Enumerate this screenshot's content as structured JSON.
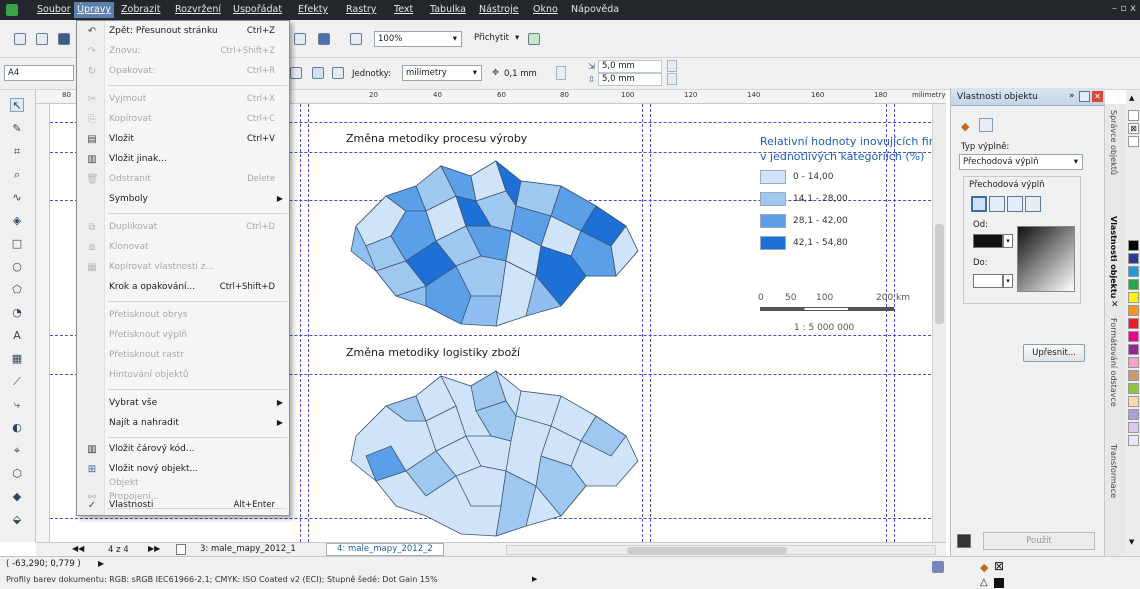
{
  "menubar": {
    "items": [
      "Soubor",
      "Úpravy",
      "Zobrazit",
      "Rozvržení",
      "Uspořádat",
      "Efekty",
      "Rastry",
      "Text",
      "Tabulka",
      "Nástroje",
      "Okno",
      "Nápověda"
    ],
    "window_controls": "– ▫ x"
  },
  "toolbar": {
    "zoom": "100%",
    "snap": "Přichytit",
    "page_size": "A4",
    "units_label": "Jednotky:",
    "units_value": "milimetry",
    "nudge": "0,1 mm",
    "dup_x": "5,0 mm",
    "dup_y": "5,0 mm"
  },
  "ruler": {
    "unit": "milimetry",
    "ticks": [
      "80",
      "20",
      "40",
      "60",
      "80",
      "100",
      "120",
      "140",
      "160",
      "180"
    ]
  },
  "edit_menu": {
    "items": [
      {
        "label": "Zpět: Přesunout stránku",
        "shortcut": "Ctrl+Z",
        "enabled": true,
        "icon": "undo-icon"
      },
      {
        "label": "Znovu:",
        "shortcut": "Ctrl+Shift+Z",
        "enabled": false,
        "icon": "redo-icon"
      },
      {
        "label": "Opakovat:",
        "shortcut": "Ctrl+R",
        "enabled": false,
        "icon": "repeat-icon"
      },
      {
        "label": "Vyjmout",
        "shortcut": "Ctrl+X",
        "enabled": false,
        "icon": "cut-icon"
      },
      {
        "label": "Kopírovat",
        "shortcut": "Ctrl+C",
        "enabled": false,
        "icon": "copy-icon"
      },
      {
        "label": "Vložit",
        "shortcut": "Ctrl+V",
        "enabled": true,
        "icon": "paste-icon"
      },
      {
        "label": "Vložit jinak...",
        "shortcut": "",
        "enabled": true,
        "icon": "paste-special-icon"
      },
      {
        "label": "Odstranit",
        "shortcut": "Delete",
        "enabled": false,
        "icon": "delete-icon"
      },
      {
        "label": "Symboly",
        "shortcut": "",
        "enabled": true,
        "icon": "",
        "submenu": true
      },
      {
        "label": "Duplikovat",
        "shortcut": "Ctrl+D",
        "enabled": false,
        "icon": "duplicate-icon"
      },
      {
        "label": "Klonovat",
        "shortcut": "",
        "enabled": false,
        "icon": "clone-icon"
      },
      {
        "label": "Kopírovat vlastnosti z...",
        "shortcut": "",
        "enabled": false,
        "icon": "copy-properties-icon"
      },
      {
        "label": "Krok a opakování...",
        "shortcut": "Ctrl+Shift+D",
        "enabled": true,
        "icon": ""
      },
      {
        "label": "Přetisknout obrys",
        "shortcut": "",
        "enabled": false,
        "icon": ""
      },
      {
        "label": "Přetisknout výplň",
        "shortcut": "",
        "enabled": false,
        "icon": ""
      },
      {
        "label": "Přetisknout rastr",
        "shortcut": "",
        "enabled": false,
        "icon": ""
      },
      {
        "label": "Hintování objektů",
        "shortcut": "",
        "enabled": false,
        "icon": ""
      },
      {
        "label": "Vybrat vše",
        "shortcut": "",
        "enabled": true,
        "icon": "",
        "submenu": true
      },
      {
        "label": "Najít a nahradit",
        "shortcut": "",
        "enabled": true,
        "icon": "",
        "submenu": true
      },
      {
        "label": "Vložit čárový kód...",
        "shortcut": "",
        "enabled": true,
        "icon": "barcode-icon"
      },
      {
        "label": "Vložit nový objekt...",
        "shortcut": "",
        "enabled": true,
        "icon": "new-object-icon"
      },
      {
        "label": "Objekt",
        "shortcut": "",
        "enabled": false,
        "icon": ""
      },
      {
        "label": "Propojení...",
        "shortcut": "",
        "enabled": false,
        "icon": "link-icon"
      },
      {
        "label": "Vlastnosti",
        "shortcut": "Alt+Enter",
        "enabled": true,
        "icon": "check-icon"
      }
    ]
  },
  "canvas": {
    "map1_title": "Změna metodiky procesu výroby",
    "map2_title": "Změna metodiky logistiky zboží",
    "legend_title_1": "Relativní hodnoty inovujících fire",
    "legend_title_2": "v jednotlivých kategoriích (%)",
    "legend": [
      {
        "label": "0 - 14,00",
        "color": "#cfe4f8"
      },
      {
        "label": "14,1 - 28,00",
        "color": "#9fc8f1"
      },
      {
        "label": "28,1 - 42,00",
        "color": "#5b9fe9"
      },
      {
        "label": "42,1 - 54,80",
        "color": "#1e6fd6"
      }
    ],
    "scale_labels": [
      "0",
      "50",
      "100",
      "200 km"
    ],
    "scale_ratio": "1 : 5 000 000"
  },
  "docker": {
    "title": "Vlastnosti objektu",
    "fill_type_label": "Typ výplně:",
    "fill_type_value": "Přechodová výplň",
    "group_label": "Přechodová výplň",
    "from_label": "Od:",
    "to_label": "Do:",
    "refine_button": "Upřesnit...",
    "apply_button": "Použít",
    "side_tabs": [
      "Správce objektů",
      "Vlastnosti objektu",
      "Formátování odstavce",
      "Transformace"
    ]
  },
  "pagebar": {
    "counter": "4 z 4",
    "tabs": [
      "3: male_mapy_2012_1",
      "4: male_mapy_2012_2"
    ]
  },
  "status": {
    "coords": "( -63,290; 0,779 )",
    "color_profiles": "Profily barev dokumentu: RGB: sRGB IEC61966-2.1; CMYK: ISO Coated v2 (ECI); Stupně šedé: Dot Gain 15%"
  },
  "palette_colors": [
    "#ffffff",
    "#000000",
    "#2b3c9a",
    "#1f9ad6",
    "#23a64a",
    "#fff200",
    "#f7941d",
    "#ed1c24",
    "#ec008c",
    "#92278f",
    "#f4a6c8",
    "#c69c6d",
    "#8dc63f",
    "#ffd8a8",
    "#a8a0d8",
    "#d8c8f0",
    "#e8e8f8"
  ]
}
